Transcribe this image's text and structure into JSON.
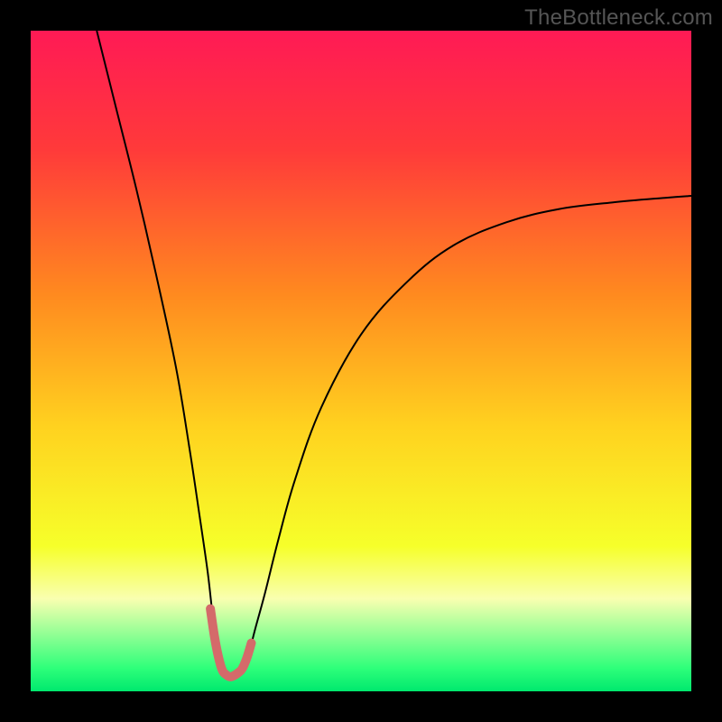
{
  "watermark": "TheBottleneck.com",
  "chart_data": {
    "type": "line",
    "title": "",
    "xlabel": "",
    "ylabel": "",
    "xlim": [
      0,
      100
    ],
    "ylim": [
      0,
      100
    ],
    "gradient_stops": [
      {
        "offset": 0.0,
        "color": "#ff1a55"
      },
      {
        "offset": 0.18,
        "color": "#ff3a3a"
      },
      {
        "offset": 0.4,
        "color": "#ff8a1f"
      },
      {
        "offset": 0.6,
        "color": "#ffd21f"
      },
      {
        "offset": 0.78,
        "color": "#f6ff2a"
      },
      {
        "offset": 0.86,
        "color": "#f9ffb0"
      },
      {
        "offset": 0.965,
        "color": "#2eff7a"
      },
      {
        "offset": 1.0,
        "color": "#00e86e"
      }
    ],
    "series": [
      {
        "name": "bottleneck-curve",
        "stroke": "#000000",
        "stroke_width": 2,
        "x": [
          10,
          13,
          16,
          19,
          22,
          24,
          25.5,
          26.8,
          27.6,
          28.3,
          29,
          29.8,
          30.5,
          31.2,
          32,
          33,
          34,
          35.5,
          37.5,
          40,
          44,
          50,
          57,
          64,
          72,
          80,
          88,
          96,
          100
        ],
        "values": [
          100,
          88,
          76,
          63,
          49,
          37,
          27,
          18,
          11,
          6.5,
          3.2,
          2.4,
          2.2,
          2.4,
          3.2,
          5.7,
          9.5,
          15,
          23,
          32,
          43,
          54,
          62,
          67.5,
          71,
          73,
          74,
          74.7,
          75
        ]
      },
      {
        "name": "optimal-range-marker",
        "stroke": "#d46a6a",
        "stroke_width": 10,
        "linecap": "round",
        "x": [
          27.2,
          27.8,
          28.4,
          29,
          29.6,
          30.2,
          30.8,
          31.4,
          32,
          32.7,
          33.4
        ],
        "values": [
          12.5,
          8.4,
          5.3,
          3.2,
          2.5,
          2.2,
          2.4,
          2.8,
          3.4,
          5,
          7.3
        ]
      }
    ]
  }
}
